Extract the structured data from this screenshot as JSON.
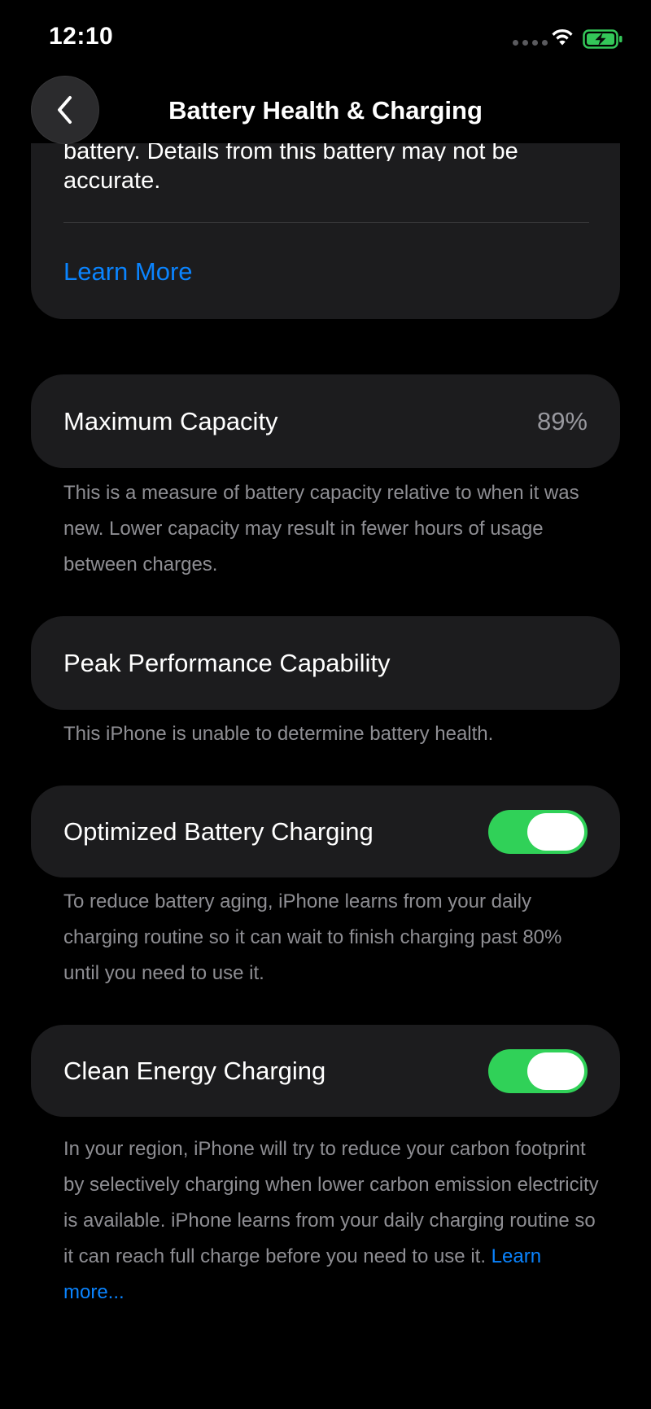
{
  "status_bar": {
    "time": "12:10",
    "icons": [
      "signal-dots-icon",
      "wifi-icon",
      "battery-charging-icon"
    ]
  },
  "header": {
    "title": "Battery Health & Charging",
    "back_icon": "chevron-left-icon"
  },
  "notice_card": {
    "text_partial_line": "battery. Details from this battery may not be",
    "text_line": "accurate.",
    "link": "Learn More"
  },
  "maximum_capacity": {
    "label": "Maximum Capacity",
    "value": "89%",
    "footer": "This is a measure of battery capacity relative to when it was new. Lower capacity may result in fewer hours of usage between charges."
  },
  "peak_performance": {
    "label": "Peak Performance Capability",
    "footer": "This iPhone is unable to determine battery health."
  },
  "optimized_charging": {
    "label": "Optimized Battery Charging",
    "enabled": true,
    "footer": "To reduce battery aging, iPhone learns from your daily charging routine so it can wait to finish charging past 80% until you need to use it."
  },
  "clean_energy": {
    "label": "Clean Energy Charging",
    "enabled": true,
    "footer": "In your region, iPhone will try to reduce your carbon footprint by selectively charging when lower carbon emission electricity is available. iPhone learns from your daily charging routine so it can reach full charge before you need to use it.",
    "footer_link": "Learn more..."
  },
  "colors": {
    "background": "#000000",
    "card": "#1c1c1e",
    "accent_link": "#0a84ff",
    "toggle_on": "#30d158",
    "secondary_text": "#8e8e93",
    "battery_green": "#34c759"
  }
}
